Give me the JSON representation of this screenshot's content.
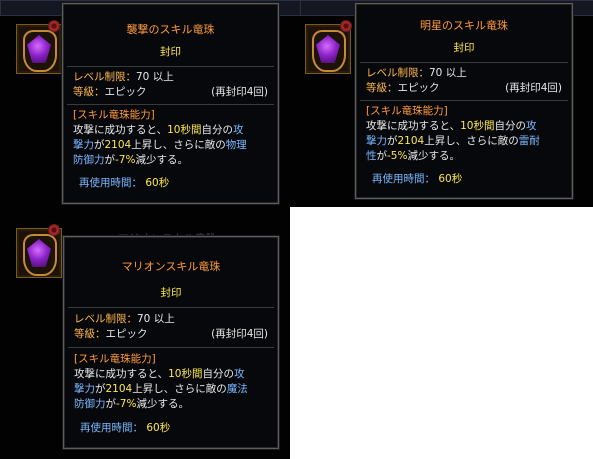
{
  "tooltips": [
    {
      "name": "襲撃のスキル竜珠",
      "seal": "封印",
      "level_label": "レベル制限：",
      "level_value": "70 以上",
      "grade_label": "等級：",
      "grade_value": "エピック",
      "reseal": "(再封印4回)",
      "section": "[スキル竜珠能力]",
      "desc": [
        [
          {
            "t": "攻撃に成功すると、",
            "c": "w"
          },
          {
            "t": "10秒間",
            "c": "y"
          },
          {
            "t": "自分の",
            "c": "w"
          },
          {
            "t": "攻",
            "c": "b"
          }
        ],
        [
          {
            "t": "撃力",
            "c": "b"
          },
          {
            "t": "が",
            "c": "w"
          },
          {
            "t": "2104",
            "c": "y"
          },
          {
            "t": "上昇し、さらに敵の",
            "c": "w"
          },
          {
            "t": "物理",
            "c": "b"
          }
        ],
        [
          {
            "t": "防御力",
            "c": "b"
          },
          {
            "t": "が",
            "c": "w"
          },
          {
            "t": "-7%",
            "c": "y"
          },
          {
            "t": "減少する。",
            "c": "w"
          }
        ]
      ],
      "cooldown_label": "再使用時間：",
      "cooldown_value": "60秒"
    },
    {
      "name": "明星のスキル竜珠",
      "seal": "封印",
      "level_label": "レベル制限：",
      "level_value": "70 以上",
      "grade_label": "等級：",
      "grade_value": "エピック",
      "reseal": "(再封印4回)",
      "section": "[スキル竜珠能力]",
      "desc": [
        [
          {
            "t": "攻撃に成功すると、",
            "c": "w"
          },
          {
            "t": "10秒間",
            "c": "y"
          },
          {
            "t": "自分の",
            "c": "w"
          },
          {
            "t": "攻",
            "c": "b"
          }
        ],
        [
          {
            "t": "撃力",
            "c": "b"
          },
          {
            "t": "が",
            "c": "w"
          },
          {
            "t": "2104",
            "c": "y"
          },
          {
            "t": "上昇し、さらに敵の",
            "c": "w"
          },
          {
            "t": "雷耐",
            "c": "b"
          }
        ],
        [
          {
            "t": "性",
            "c": "b"
          },
          {
            "t": "が",
            "c": "w"
          },
          {
            "t": "-5%",
            "c": "y"
          },
          {
            "t": "減少する。",
            "c": "w"
          }
        ]
      ],
      "cooldown_label": "再使用時間：",
      "cooldown_value": "60秒"
    },
    {
      "name": "マリオンスキル竜珠",
      "seal": "封印",
      "level_label": "レベル制限：",
      "level_value": "70 以上",
      "grade_label": "等級：",
      "grade_value": "エピック",
      "reseal": "(再封印4回)",
      "section": "[スキル竜珠能力]",
      "desc": [
        [
          {
            "t": "攻撃に成功すると、",
            "c": "w"
          },
          {
            "t": "10秒間",
            "c": "y"
          },
          {
            "t": "自分の",
            "c": "w"
          },
          {
            "t": "攻",
            "c": "b"
          }
        ],
        [
          {
            "t": "撃力",
            "c": "b"
          },
          {
            "t": "が",
            "c": "w"
          },
          {
            "t": "2104",
            "c": "y"
          },
          {
            "t": "上昇し、さらに敵の",
            "c": "w"
          },
          {
            "t": "魔法",
            "c": "b"
          }
        ],
        [
          {
            "t": "防御力",
            "c": "b"
          },
          {
            "t": "が",
            "c": "w"
          },
          {
            "t": "-7%",
            "c": "y"
          },
          {
            "t": "減少する。",
            "c": "w"
          }
        ]
      ],
      "cooldown_label": "再使用時間：",
      "cooldown_value": "60秒"
    }
  ],
  "ghost_title": "マリオンスキル竜珠",
  "colors": {
    "name": "#ff9a3a",
    "seal": "#ffe84a",
    "label": "#ffb74a",
    "blue": "#7ab8ff",
    "yellow": "#ffe84a"
  },
  "icons": [
    "dragon-orb-icon",
    "gear-icon"
  ]
}
